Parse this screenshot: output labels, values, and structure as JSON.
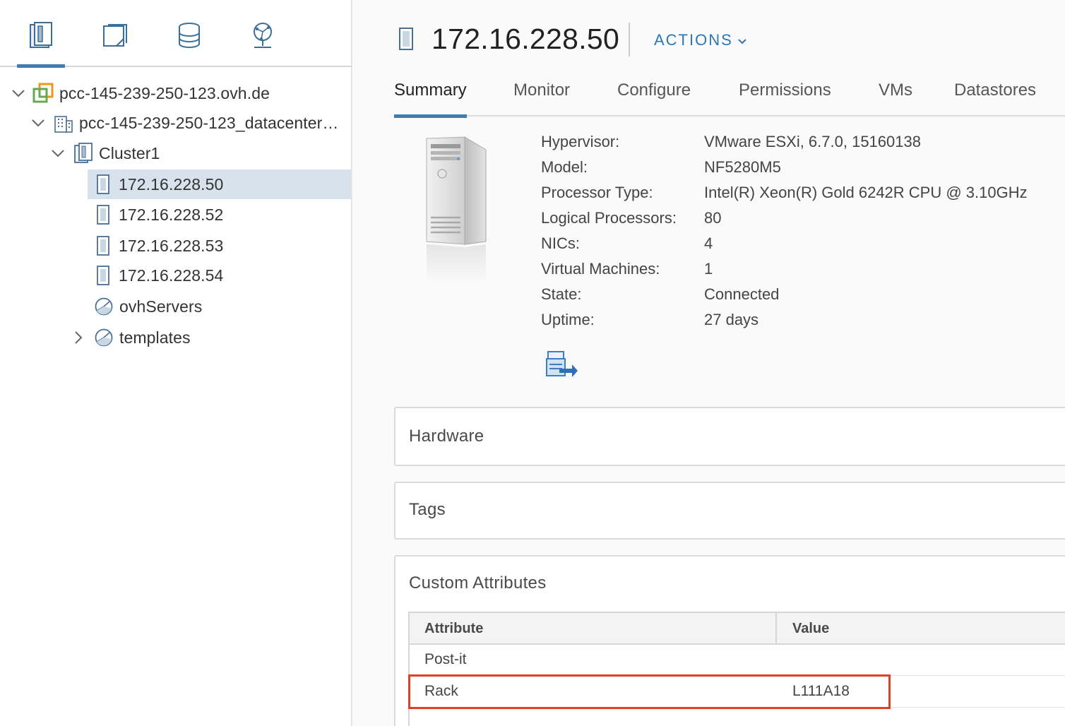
{
  "navigator": {
    "tabs": [
      {
        "icon": "hosts-clusters-icon",
        "active": true
      },
      {
        "icon": "vms-templates-icon",
        "active": false
      },
      {
        "icon": "storage-icon",
        "active": false
      },
      {
        "icon": "networking-icon",
        "active": false
      }
    ],
    "tree": {
      "vcenter": "pcc-145-239-250-123.ovh.de",
      "datacenter": "pcc-145-239-250-123_datacenter…",
      "cluster": "Cluster1",
      "hosts": [
        "172.16.228.50",
        "172.16.228.52",
        "172.16.228.53",
        "172.16.228.54"
      ],
      "pools": [
        "ovhServers",
        "templates"
      ]
    }
  },
  "header": {
    "title": "172.16.228.50",
    "actions_label": "ACTIONS"
  },
  "tabs": [
    "Summary",
    "Monitor",
    "Configure",
    "Permissions",
    "VMs",
    "Datastores"
  ],
  "summary": {
    "props": [
      {
        "k": "Hypervisor:",
        "v": "VMware ESXi, 6.7.0, 15160138"
      },
      {
        "k": "Model:",
        "v": "NF5280M5"
      },
      {
        "k": "Processor Type:",
        "v": "Intel(R) Xeon(R) Gold 6242R CPU @ 3.10GHz"
      },
      {
        "k": "Logical Processors:",
        "v": "80"
      },
      {
        "k": "NICs:",
        "v": "4"
      },
      {
        "k": "Virtual Machines:",
        "v": "1"
      },
      {
        "k": "State:",
        "v": "Connected"
      },
      {
        "k": "Uptime:",
        "v": "27 days"
      }
    ]
  },
  "cards": {
    "hardware": "Hardware",
    "tags": "Tags",
    "custom_attributes": "Custom Attributes"
  },
  "attributes_table": {
    "headers": [
      "Attribute",
      "Value"
    ],
    "rows": [
      {
        "attribute": "Post-it",
        "value": ""
      },
      {
        "attribute": "Rack",
        "value": "L111A18"
      }
    ]
  },
  "colors": {
    "accent": "#3c7cb7",
    "link": "#2f76b6",
    "selection": "#d8e2ec",
    "highlight_border": "#e0402a"
  }
}
